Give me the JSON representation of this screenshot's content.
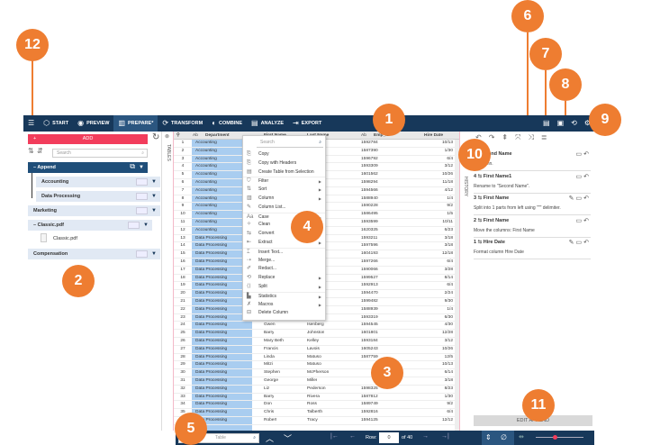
{
  "toolbar": {
    "tabs": [
      {
        "label": "START",
        "icon": "cube-icon"
      },
      {
        "label": "PREVIEW",
        "icon": "eye-icon"
      },
      {
        "label": "PREPARE*",
        "icon": "prepare-icon"
      },
      {
        "label": "TRANSFORM",
        "icon": "transform-icon"
      },
      {
        "label": "COMBINE",
        "icon": "combine-icon"
      },
      {
        "label": "ANALYZE",
        "icon": "analyze-icon"
      },
      {
        "label": "EXPORT",
        "icon": "export-icon"
      }
    ],
    "active": "PREPARE*"
  },
  "left": {
    "add_label": "ADD",
    "search_placeholder": "Search",
    "tables_label": "TABLES",
    "items": [
      "Append",
      "Accounting",
      "Data Processing",
      "Marketing",
      "Classic.pdf",
      "Classic.pdf",
      "Compensation"
    ]
  },
  "grid": {
    "headers": [
      "Department",
      "First Name",
      "Last Name",
      "Emp_ID",
      "Hire Date"
    ],
    "type_label": "Ab",
    "rows": [
      [
        "1",
        "Accounting",
        "",
        "",
        "1592784",
        "10/13"
      ],
      [
        "2",
        "Accounting",
        "",
        "",
        "1587390",
        "1/30"
      ],
      [
        "3",
        "Accounting",
        "",
        "",
        "1596792",
        "6/4"
      ],
      [
        "4",
        "Accounting",
        "",
        "",
        "1593309",
        "3/12"
      ],
      [
        "5",
        "Accounting",
        "",
        "",
        "1601562",
        "10/26"
      ],
      [
        "6",
        "Accounting",
        "",
        "",
        "1598294",
        "11/18"
      ],
      [
        "7",
        "Accounting",
        "",
        "",
        "1594566",
        "4/12"
      ],
      [
        "8",
        "Accounting",
        "",
        "",
        "1588940",
        "1/4"
      ],
      [
        "9",
        "Accounting",
        "",
        "",
        "1590228",
        "9/2"
      ],
      [
        "10",
        "Accounting",
        "",
        "",
        "1586495",
        "1/5"
      ],
      [
        "11",
        "Accounting",
        "",
        "",
        "1593599",
        "10/11"
      ],
      [
        "12",
        "Accounting",
        "",
        "",
        "1620325",
        "6/23"
      ],
      [
        "13",
        "Data Processing",
        "",
        "",
        "1593211",
        "3/18"
      ],
      [
        "14",
        "Data Processing",
        "",
        "",
        "1597596",
        "3/18"
      ],
      [
        "15",
        "Data Processing",
        "",
        "",
        "1604193",
        "12/18"
      ],
      [
        "16",
        "Data Processing",
        "",
        "",
        "1597266",
        "6/4"
      ],
      [
        "17",
        "Data Processing",
        "",
        "",
        "1590066",
        "3/28"
      ],
      [
        "18",
        "Data Processing",
        "",
        "",
        "1599527",
        "8/14"
      ],
      [
        "19",
        "Data Processing",
        "",
        "",
        "1592913",
        "6/4"
      ],
      [
        "20",
        "Data Processing",
        "",
        "",
        "1594470",
        "2/24"
      ],
      [
        "21",
        "Data Processing",
        "",
        "",
        "1599482",
        "9/30"
      ],
      [
        "22",
        "Data Processing",
        "",
        "",
        "1588939",
        "1/4"
      ],
      [
        "23",
        "Data Processing",
        "Lynn",
        "Hubbard",
        "1593319",
        "6/30"
      ],
      [
        "24",
        "Data Processing",
        "Gwen",
        "Isenberg",
        "1594545",
        "4/30"
      ],
      [
        "25",
        "Data Processing",
        "Barry",
        "Johnston",
        "1601801",
        "12/28"
      ],
      [
        "26",
        "Data Processing",
        "Mary Beth",
        "Kelley",
        "1593184",
        "3/12"
      ],
      [
        "27",
        "Data Processing",
        "Francis",
        "Lavois",
        "1605243",
        "10/26"
      ],
      [
        "28",
        "Data Processing",
        "Linda",
        "Matuso",
        "1587759",
        "12/5"
      ],
      [
        "29",
        "Data Processing",
        "Mitzi",
        "Matuso",
        "",
        "10/13"
      ],
      [
        "30",
        "Data Processing",
        "Stephen",
        "McPherson",
        "",
        "6/14"
      ],
      [
        "31",
        "Data Processing",
        "George",
        "Miller",
        "",
        "3/18"
      ],
      [
        "32",
        "Data Processing",
        "Liz",
        "Pederson",
        "1598325",
        "8/23"
      ],
      [
        "33",
        "Data Processing",
        "Barry",
        "Rivera",
        "1587812",
        "1/30"
      ],
      [
        "34",
        "Data Processing",
        "Don",
        "Ross",
        "1589749",
        "9/2"
      ],
      [
        "35",
        "Data Processing",
        "Chris",
        "Talberth",
        "1592816",
        "6/4"
      ],
      [
        "36",
        "Data Processing",
        "Robert",
        "Tracy",
        "1594125",
        "12/12"
      ]
    ]
  },
  "menu": {
    "search_placeholder": "Search",
    "items": [
      {
        "label": "Copy",
        "sub": false
      },
      {
        "label": "Copy with Headers",
        "sub": false
      },
      {
        "label": "Create Table from Selection",
        "sub": false
      },
      {
        "label": "Filter",
        "sub": true
      },
      {
        "label": "Sort",
        "sub": true
      },
      {
        "label": "Column",
        "sub": true
      },
      {
        "label": "Column List...",
        "sub": false
      },
      {
        "label": "Case",
        "sub": true
      },
      {
        "label": "Clean",
        "sub": false
      },
      {
        "label": "Convert",
        "sub": false
      },
      {
        "label": "Extract",
        "sub": true
      },
      {
        "label": "Insert Text...",
        "sub": false
      },
      {
        "label": "Merge...",
        "sub": false
      },
      {
        "label": "Redact...",
        "sub": false
      },
      {
        "label": "Replace",
        "sub": true
      },
      {
        "label": "Split",
        "sub": true
      },
      {
        "label": "Statistics",
        "sub": true
      },
      {
        "label": "Macros",
        "sub": true
      },
      {
        "label": "Delete Column",
        "sub": false
      }
    ]
  },
  "history": {
    "label": "HISTORY",
    "items": [
      {
        "num": "",
        "title": "Second Name",
        "desc": "a column.",
        "edit": false
      },
      {
        "num": "4",
        "title": "First Name1",
        "desc": "Rename to \"Second Name\".",
        "edit": false
      },
      {
        "num": "3",
        "title": "First Name",
        "desc": "Split into 1 parts from left using \"\"\" delimiter.",
        "edit": true
      },
      {
        "num": "2",
        "title": "First Name",
        "desc": "Move the columns: First Name",
        "edit": false
      },
      {
        "num": "1",
        "title": "Hire Date",
        "desc": "Format column Hire Date",
        "edit": true
      }
    ],
    "edit_append": "EDIT APPEND"
  },
  "bottom": {
    "search_placeholder": "Table",
    "row_label": "Row:",
    "row_value": "0",
    "of_label": "of 40",
    "zoom_percent": 40
  },
  "callouts": [
    "12",
    "1",
    "6",
    "7",
    "8",
    "9",
    "2",
    "4",
    "3",
    "10",
    "11",
    "5"
  ],
  "colors": {
    "toolbar": "#17385a",
    "accent": "#f23d5c",
    "callout": "#ee7d31",
    "selected_column": "#a9cdf0"
  }
}
